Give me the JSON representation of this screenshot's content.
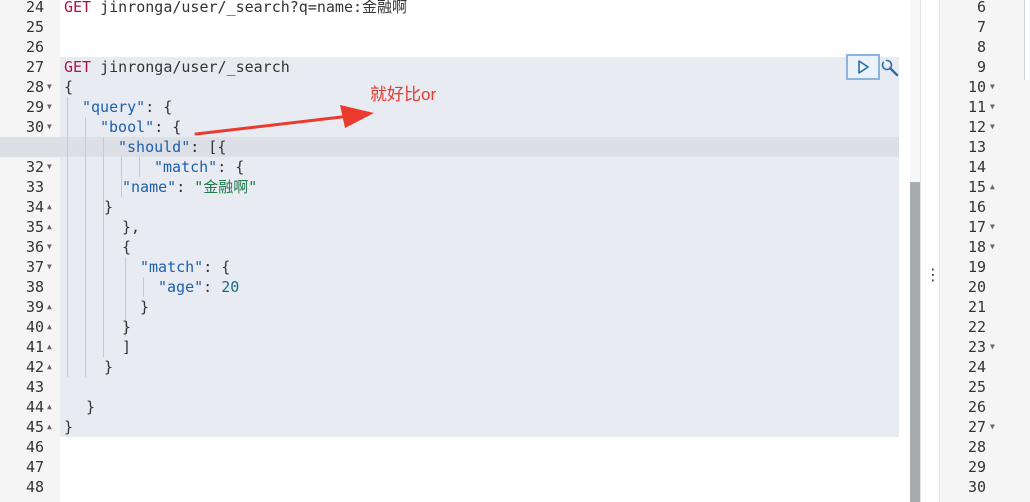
{
  "editor": {
    "line_numbers": [
      "24",
      "25",
      "26",
      "27",
      "28",
      "29",
      "30",
      "31",
      "32",
      "33",
      "34",
      "35",
      "36",
      "37",
      "38",
      "39",
      "40",
      "41",
      "42",
      "43",
      "44",
      "45",
      "46",
      "47",
      "48"
    ],
    "line_24": {
      "method": "GET",
      "path": "jinronga/user/_search?q=name:金融啊"
    },
    "line_27": {
      "method": "GET",
      "path": "jinronga/user/_search"
    },
    "line_28": "{",
    "line_29": {
      "key": "\"query\"",
      "rest": ": {"
    },
    "line_30": {
      "key": "\"bool\"",
      "rest": ": {"
    },
    "line_31": {
      "key": "\"should\"",
      "rest": ": [{"
    },
    "line_32": {
      "key": "\"match\"",
      "rest": ": {"
    },
    "line_33": {
      "key": "\"name\"",
      "sep": ": ",
      "value": "\"金融啊\""
    },
    "line_34": "}",
    "line_35": "},",
    "line_36": "{",
    "line_37": {
      "key": "\"match\"",
      "rest": ": {"
    },
    "line_38": {
      "key": "\"age\"",
      "sep": ": ",
      "value": "20"
    },
    "line_39": "}",
    "line_40": "}",
    "line_41": "]",
    "line_42": "}",
    "line_44": "}",
    "line_45": "}"
  },
  "output": {
    "line_numbers": [
      "6",
      "7",
      "8",
      "9",
      "10",
      "11",
      "12",
      "13",
      "14",
      "15",
      "16",
      "17",
      "18",
      "19",
      "20",
      "21",
      "22",
      "23",
      "24",
      "25",
      "26",
      "27",
      "28",
      "29",
      "30"
    ]
  },
  "annotation": {
    "text": "就好比or",
    "color": "#e23a2e"
  },
  "icons": {
    "run": "play-icon",
    "settings": "wrench-icon",
    "resize": "vertical-dots-icon"
  },
  "colors": {
    "method": "#b00f4a",
    "key": "#1c5fae",
    "string_value": "#1f7a4a",
    "number_value": "#1b6a8a",
    "active_button_border": "#8cb4dc"
  }
}
